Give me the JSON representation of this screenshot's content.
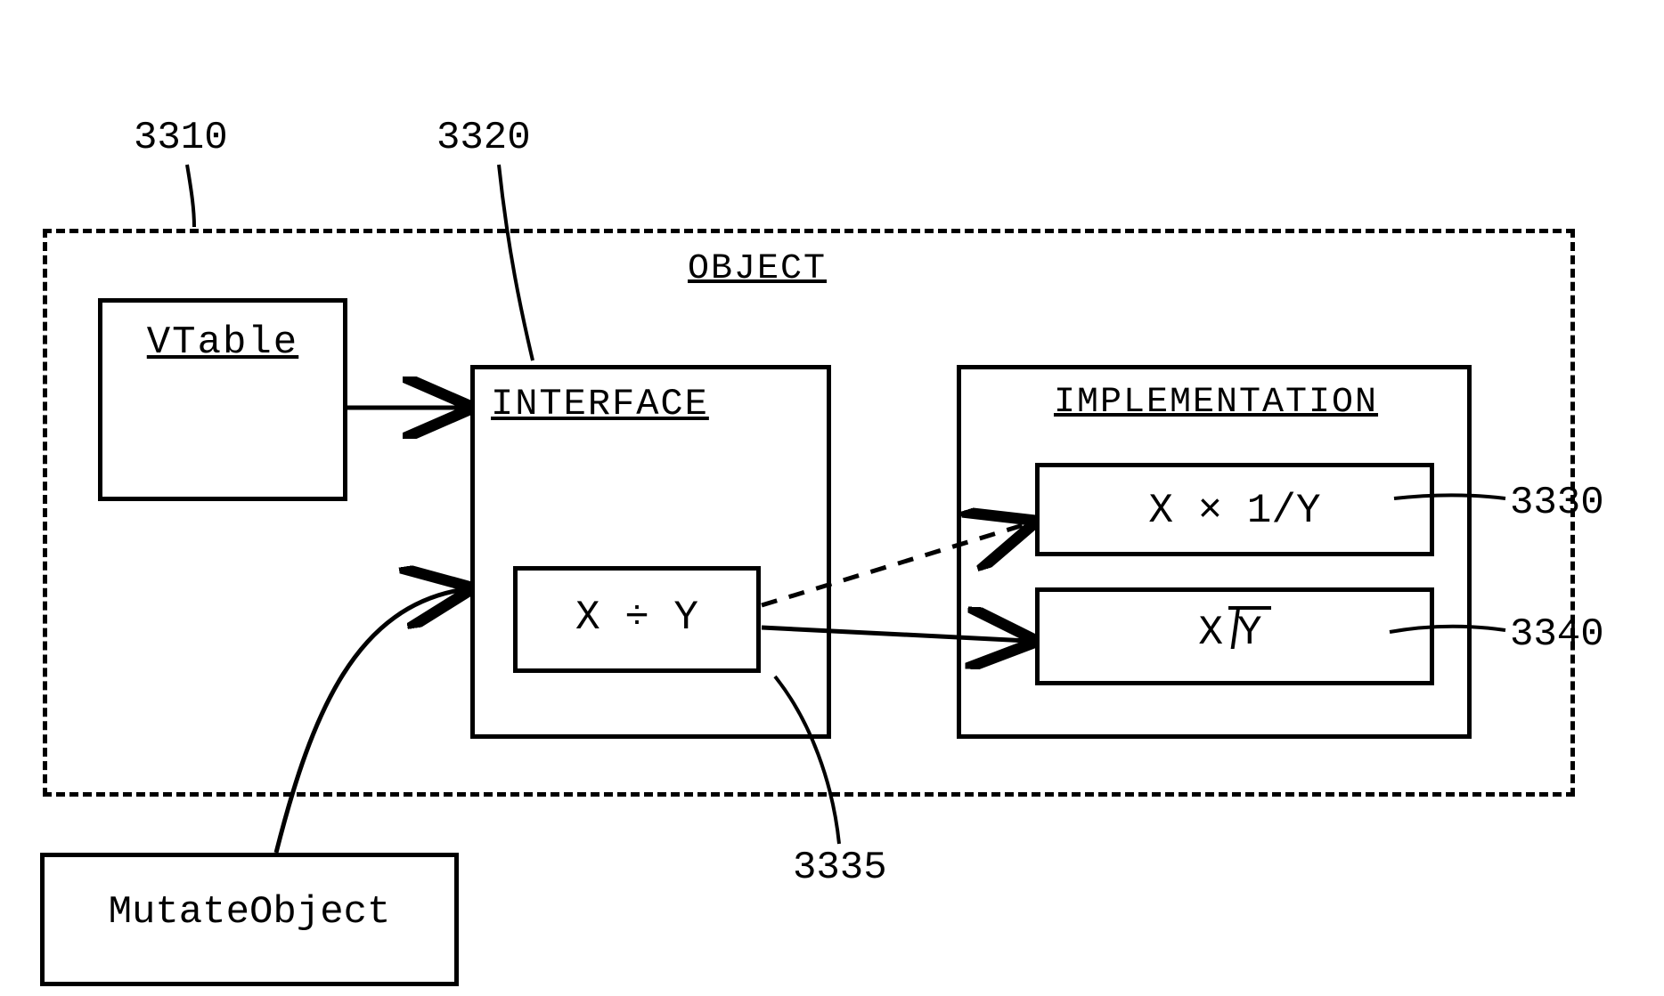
{
  "refs": {
    "object": "3310",
    "interface": "3320",
    "impl1": "3330",
    "interface_op": "3335",
    "impl2": "3340"
  },
  "object": {
    "title": "OBJECT",
    "vtable": {
      "title": "VTable"
    },
    "interface": {
      "title": "INTERFACE",
      "operation": "X ÷ Y"
    },
    "implementation": {
      "title": "IMPLEMENTATION",
      "impl1_text": "X × 1/Y",
      "impl2_divisor": "X",
      "impl2_dividend": "Y"
    }
  },
  "mutate": {
    "label": "MutateObject"
  }
}
